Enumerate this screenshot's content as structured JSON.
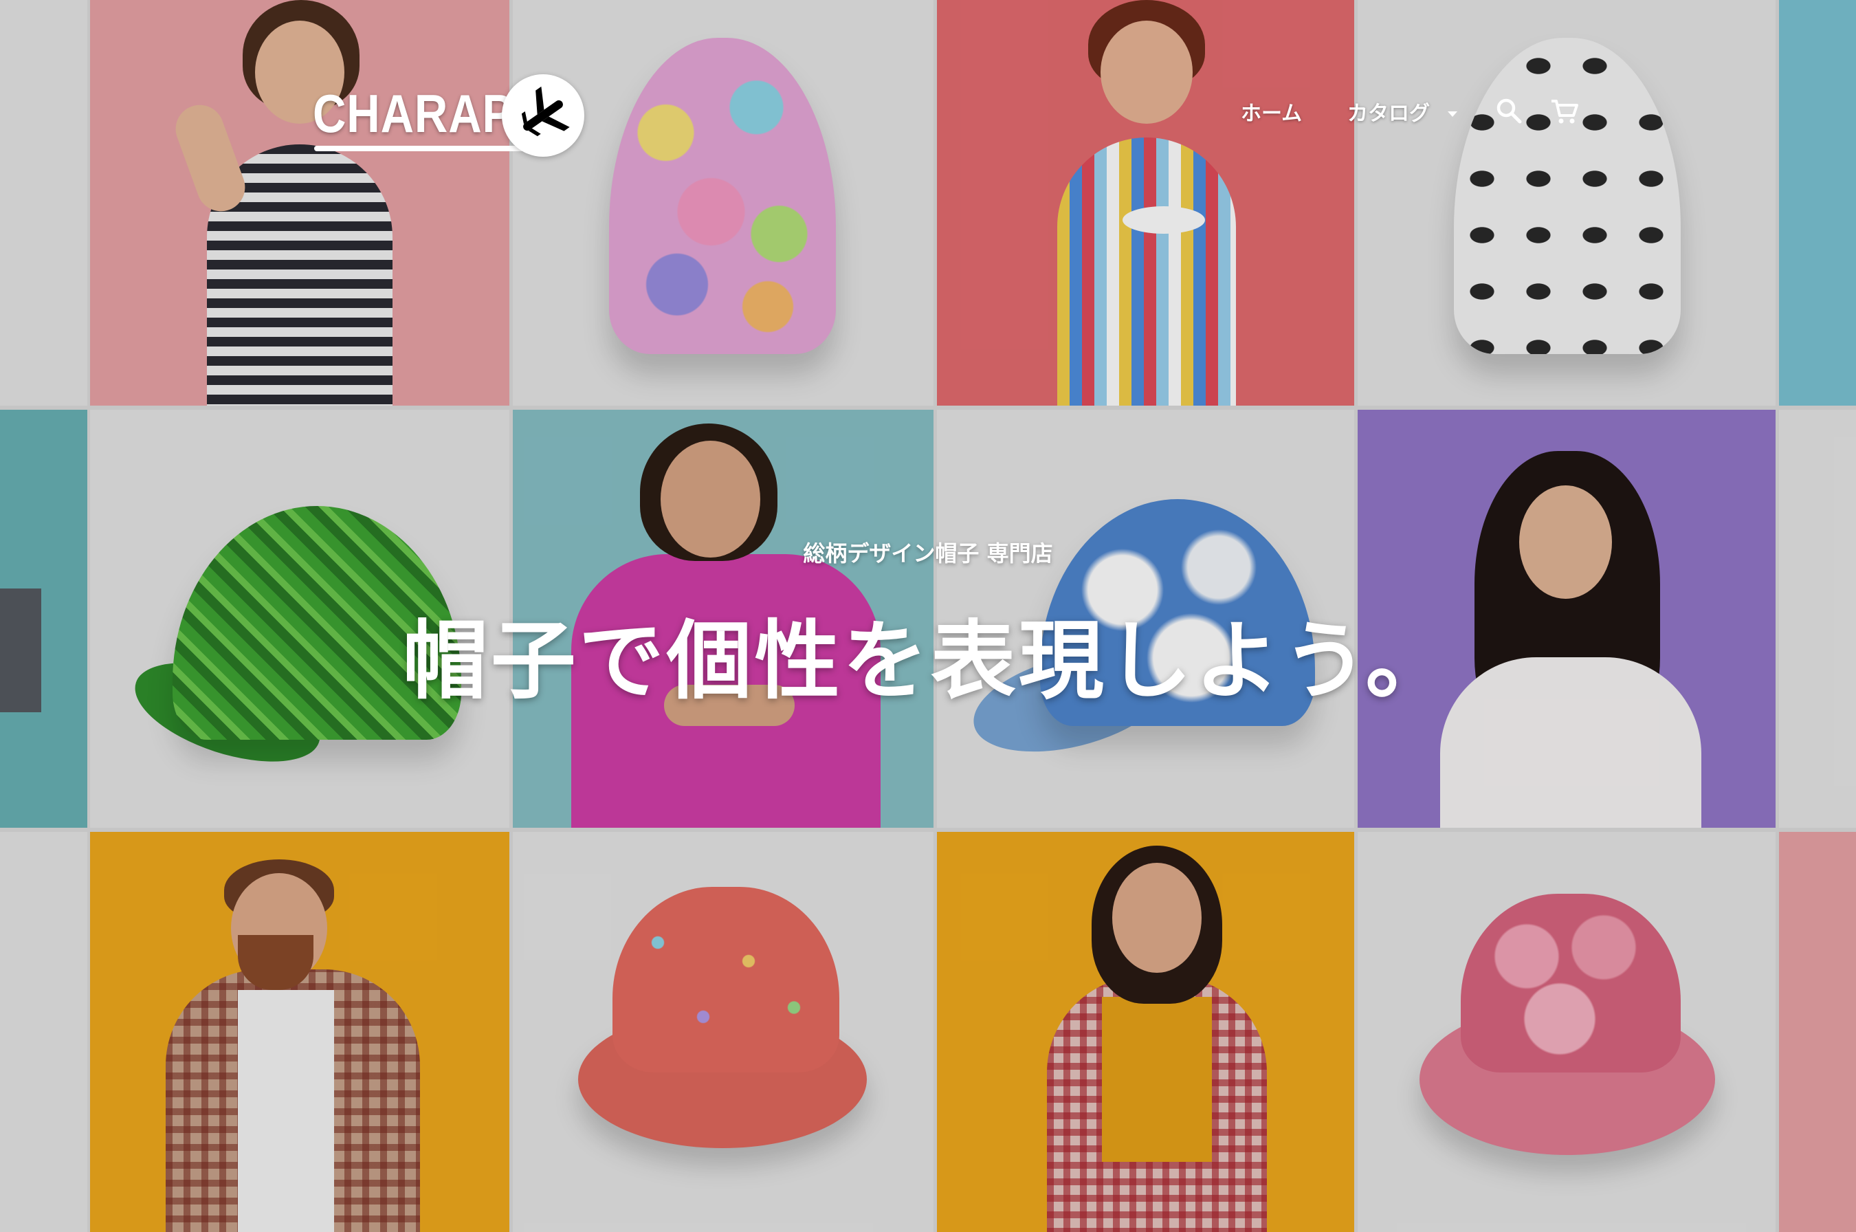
{
  "header": {
    "logo_text": "CHARAP",
    "nav": {
      "home": "ホーム",
      "catalog": "カタログ"
    },
    "icons": [
      "search-icon",
      "cart-icon",
      "plane-icon",
      "chevron-down-icon"
    ]
  },
  "hero": {
    "subtitle": "総柄デザイン帽子 専門店",
    "title": "帽子で個性を表現しよう。"
  },
  "colors": {
    "tile_pink": "#e9a3a6",
    "tile_coral": "#e46b6f",
    "tile_teal": "#68b1b5",
    "tile_blue": "#7bc3d4",
    "tile_purple": "#9276c9",
    "tile_yellow": "#f0aa1c",
    "tile_grey": "#e6e6e6",
    "hero_text": "#ffffff"
  }
}
